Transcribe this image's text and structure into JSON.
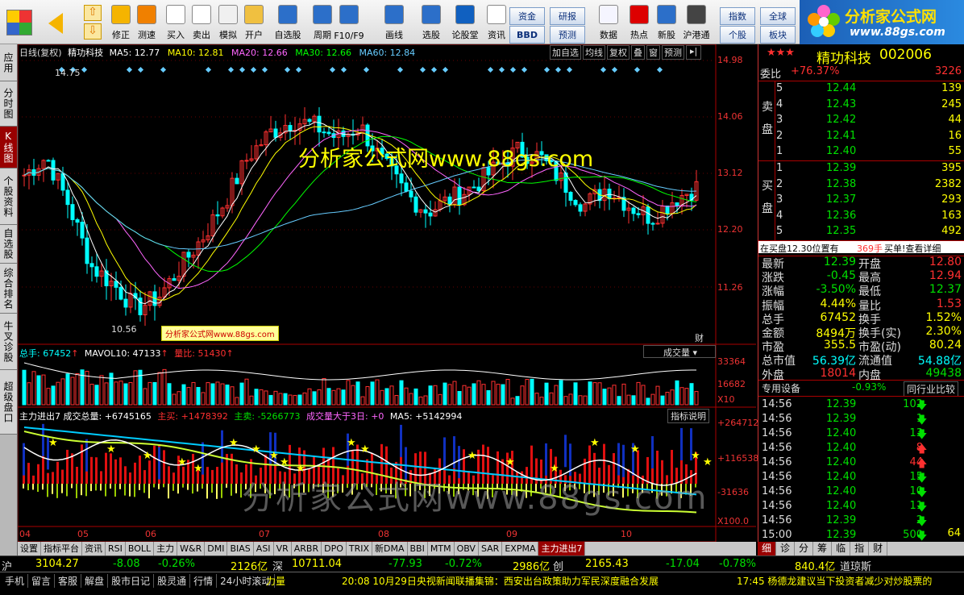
{
  "toolbar": {
    "buttons": [
      {
        "label": "修正",
        "icon": "up-arrow-icon"
      },
      {
        "label": "测速",
        "icon": "speed-icon"
      },
      {
        "label": "买入",
        "icon": "buy-icon"
      },
      {
        "label": "卖出",
        "icon": "sell-icon"
      },
      {
        "label": "模拟",
        "icon": "hammer-icon"
      },
      {
        "label": "开户",
        "icon": "lock-icon"
      },
      {
        "label": "自选股",
        "icon": "star-icon"
      },
      {
        "label": "周期",
        "icon": "clock-icon"
      },
      {
        "label": "F10/F9",
        "icon": "f10-icon"
      },
      {
        "label": "画线",
        "icon": "pen-icon"
      },
      {
        "label": "选股",
        "icon": "select-icon"
      },
      {
        "label": "论股堂",
        "icon": "forum-icon"
      },
      {
        "label": "资讯",
        "icon": "info-icon"
      },
      {
        "label": "数据",
        "icon": "pe-icon"
      },
      {
        "label": "热点",
        "icon": "hot-icon"
      },
      {
        "label": "新股",
        "icon": "newstock-icon"
      },
      {
        "label": "沪港通",
        "icon": "hk-icon"
      }
    ],
    "small": [
      "资金",
      "BBD",
      "研报",
      "预测",
      "指数",
      "个股",
      "全球",
      "板块"
    ]
  },
  "logo": {
    "title": "分析家公式网",
    "url": "www.88gs.com"
  },
  "leftbar": [
    "应用",
    "分时图",
    "K线图",
    "个股资料",
    "自选股",
    "综合排名",
    "牛叉诊股",
    "超级盘口"
  ],
  "chart": {
    "header": {
      "name": "日线(复权)",
      "stock": "精功科技",
      "ma5": "MA5: 12.77",
      "ma10": "MA10: 12.81",
      "ma20": "MA20: 12.66",
      "ma30": "MA30: 12.66",
      "ma60": "MA60: 12.84",
      "buttons": [
        "加自选",
        "均线",
        "复权",
        "叠",
        "窗",
        "预测"
      ]
    },
    "price_axis": [
      "14.98",
      "14.06",
      "13.12",
      "12.20",
      "11.26"
    ],
    "hi": "14.75",
    "lo": "10.56",
    "watermark": "分析家公式网www.88gs.com",
    "watermark2": "分析家公式网www.88gs.com",
    "watermark3": "分析家公式网www.88gs.com",
    "fin": "财",
    "vol_header": {
      "a": "总手: 67452",
      "b": "MAVOL10: 47133",
      "c": "量比: 51430",
      "btn": "成交量"
    },
    "vol_axis": [
      "33364",
      "16682",
      "X10"
    ],
    "ind_header": {
      "a": "主力进出7 成交总量: +6745165",
      "b": "主买: +1478392",
      "c": "主卖: -5266773",
      "d": "成交量大于3日: +0",
      "e": "MA5: +5142994",
      "btn": "指标说明"
    },
    "ind_axis": [
      "+264712",
      "+116538",
      "-31636",
      "X100.0"
    ],
    "months": [
      "04",
      "05",
      "06",
      "07",
      "08",
      "09",
      "10"
    ]
  },
  "tabs": [
    "设置",
    "指标平台",
    "资讯",
    "RSI",
    "BOLL",
    "主力",
    "W&R",
    "DMI",
    "BIAS",
    "ASI",
    "VR",
    "ARBR",
    "DPO",
    "TRIX",
    "新DMA",
    "BBI",
    "MTM",
    "OBV",
    "SAR",
    "EXPMA",
    "主力进出7"
  ],
  "quote": {
    "stars": "★★★",
    "name": "精功科技",
    "code": "002006",
    "weibi_label": "委比",
    "weibi": "+76.37%",
    "weicha": "3226",
    "sell_label": "卖盘",
    "buy_label": "买盘",
    "sells": [
      [
        "5",
        "12.44",
        "139"
      ],
      [
        "4",
        "12.43",
        "245"
      ],
      [
        "3",
        "12.42",
        "44"
      ],
      [
        "2",
        "12.41",
        "16"
      ],
      [
        "1",
        "12.40",
        "55"
      ]
    ],
    "buys": [
      [
        "1",
        "12.39",
        "395"
      ],
      [
        "2",
        "12.38",
        "2382"
      ],
      [
        "3",
        "12.37",
        "293"
      ],
      [
        "4",
        "12.36",
        "163"
      ],
      [
        "5",
        "12.35",
        "492"
      ]
    ],
    "notice": "在买盘12.30位置有",
    "notice_vol": "369手",
    "notice_link": "买单!查看详细",
    "stats": [
      [
        "最新",
        "12.39",
        "开盘",
        "12.80"
      ],
      [
        "涨跌",
        "-0.45",
        "最高",
        "12.94"
      ],
      [
        "涨幅",
        "-3.50%",
        "最低",
        "12.37"
      ],
      [
        "振幅",
        "4.44%",
        "量比",
        "1.53"
      ],
      [
        "总手",
        "67452",
        "换手",
        "1.52%"
      ],
      [
        "金额",
        "8494万",
        "换手(实)",
        "2.30%"
      ],
      [
        "市盈",
        "355.5",
        "市盈(动)",
        "80.24"
      ],
      [
        "总市值",
        "56.39亿",
        "流通值",
        "54.88亿"
      ],
      [
        "外盘",
        "18014",
        "内盘",
        "49438"
      ]
    ],
    "sector": "专用设备",
    "sector_chg": "-0.93%",
    "compare": "同行业比较",
    "ticks": [
      [
        "14:56",
        "12.39",
        "102",
        "down"
      ],
      [
        "14:56",
        "12.39",
        "1",
        "down"
      ],
      [
        "14:56",
        "12.40",
        "13",
        "down"
      ],
      [
        "14:56",
        "12.40",
        "8",
        "up"
      ],
      [
        "14:56",
        "12.40",
        "44",
        "up"
      ],
      [
        "14:56",
        "12.40",
        "15",
        "down"
      ],
      [
        "14:56",
        "12.40",
        "10",
        "down"
      ],
      [
        "14:56",
        "12.40",
        "11",
        "down"
      ],
      [
        "14:56",
        "12.39",
        "2",
        "down"
      ],
      [
        "15:00",
        "12.39",
        "500",
        "down"
      ]
    ],
    "tick_extra": "64",
    "rtabs": [
      "细",
      "诊",
      "分",
      "筹",
      "临",
      "指",
      "财"
    ]
  },
  "index": {
    "sh": "沪",
    "sh_v": "3104.27",
    "sh_c": "-8.08",
    "sh_p": "-0.26%",
    "sh_a": "2126亿",
    "sz": "深",
    "sz_v": "10711.04",
    "sz_c": "-77.93",
    "sz_p": "-0.72%",
    "sz_a": "2986亿",
    "cy": "创",
    "cy_v": "2165.43",
    "cy_c": "-17.04",
    "cy_p": "-0.78%",
    "cy_a": "840.4亿",
    "dj": "道琼斯"
  },
  "status": {
    "items": [
      "手机",
      "留言",
      "客服",
      "解盘",
      "股市日记",
      "股灵通",
      "行情",
      "24小时滚动"
    ],
    "power": "力量",
    "news1": "20:08 10月29日央视新闻联播集锦：西安出台政策助力军民深度融合发展",
    "news2": "17:45 杨德龙建议当下投资者减少对炒股票的"
  }
}
